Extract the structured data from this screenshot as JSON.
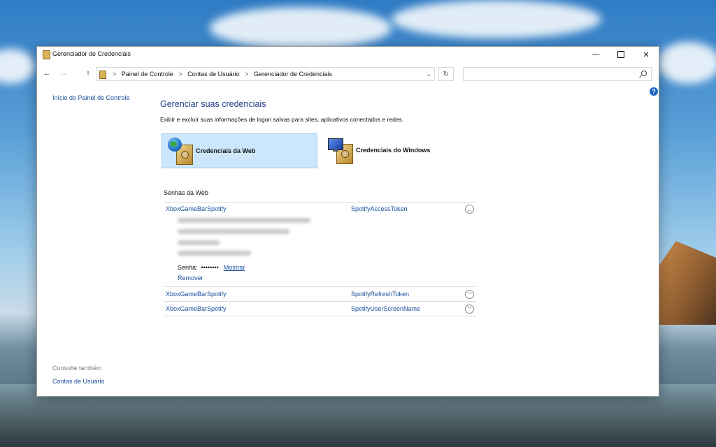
{
  "window": {
    "title": "Gerenciador de Credenciais",
    "controls": {
      "minimize": "—",
      "close": "✕"
    }
  },
  "navigation": {
    "back": "←",
    "forward": "→",
    "up": "↑",
    "breadcrumbs": [
      "Painel de Controle",
      "Contas de Usuário",
      "Gerenciador de Credenciais"
    ],
    "separator": ">",
    "dropdown": "⌄",
    "refresh": "↻",
    "search_placeholder": ""
  },
  "help": "?",
  "left_pane": {
    "home_link": "Início do Painel de Controle",
    "see_also_heading": "Consulte também",
    "see_also_link": "Contas de Usuário"
  },
  "main": {
    "heading": "Gerenciar suas credenciais",
    "description": "Exibir e excluir suas informações de logon salvas para sites, aplicativos conectados e redes.",
    "categories": [
      {
        "label": "Credenciais da Web",
        "icon": "globe-safe-icon",
        "selected": true
      },
      {
        "label": "Credenciais do Windows",
        "icon": "monitor-safe-icon",
        "selected": false
      }
    ],
    "section_title": "Senhas da Web",
    "credentials": [
      {
        "site": "XboxGameBarSpotify",
        "name": "SpotifyAccessToken",
        "expanded": true,
        "password_label": "Senha:",
        "password_mask": "••••••••",
        "show_label": "Mostrar",
        "remove_label": "Remover"
      },
      {
        "site": "XboxGameBarSpotify",
        "name": "SpotifyRefreshToken",
        "expanded": false
      },
      {
        "site": "XboxGameBarSpotify",
        "name": "SpotifyUserScreenName",
        "expanded": false
      }
    ],
    "toggle_glyphs": {
      "collapse": "︿",
      "expand": "﹀"
    }
  },
  "colors": {
    "link": "#1a4f9c",
    "heading": "#1e3d82",
    "selected_tile": "#cce6fb",
    "help_badge": "#1a66c4"
  }
}
